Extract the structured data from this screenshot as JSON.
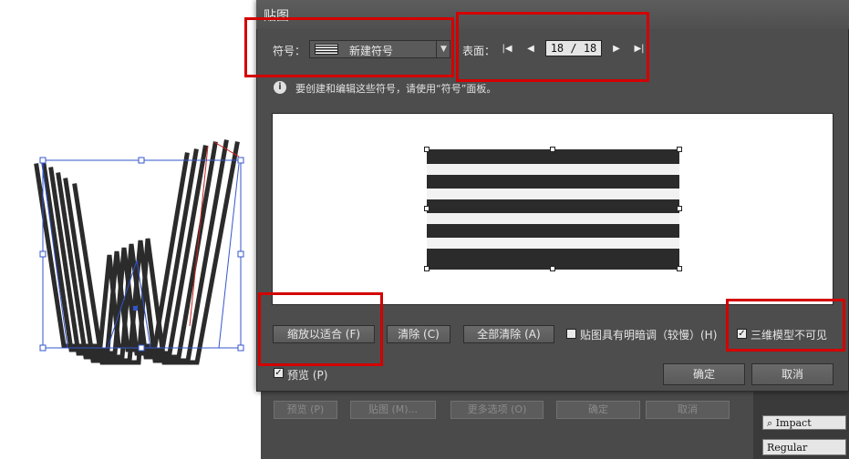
{
  "dialog": {
    "title": "贴图",
    "symbol_label": "符号：",
    "symbol_value": "新建符号",
    "surface_label": "表面：",
    "page_value": "18 / 18",
    "info_text": "要创建和编辑这些符号，请使用“符号”面板。",
    "buttons": {
      "scale_to_fit": "缩放以适合 (F)",
      "clear": "清除 (C)",
      "clear_all": "全部清除 (A)",
      "ok": "确定",
      "cancel": "取消"
    },
    "checkboxes": {
      "shade_artwork": "贴图具有明暗调（较慢）(H)",
      "invisible_geometry": "三维模型不可见",
      "preview": "预览 (P)"
    }
  },
  "background": {
    "old_dialog_buttons": [
      "预览 (P)",
      "贴图 (M)...",
      "更多选项 (O)",
      "确定",
      "取消"
    ],
    "font_name": "Impact",
    "font_style": "Regular"
  },
  "colors": {
    "highlight": "#d40000",
    "dialog_bg": "#4d4d4d",
    "stripe_dark": "#2b2b2b",
    "selection_blue": "#3355cc",
    "selection_red": "#cc2222"
  }
}
